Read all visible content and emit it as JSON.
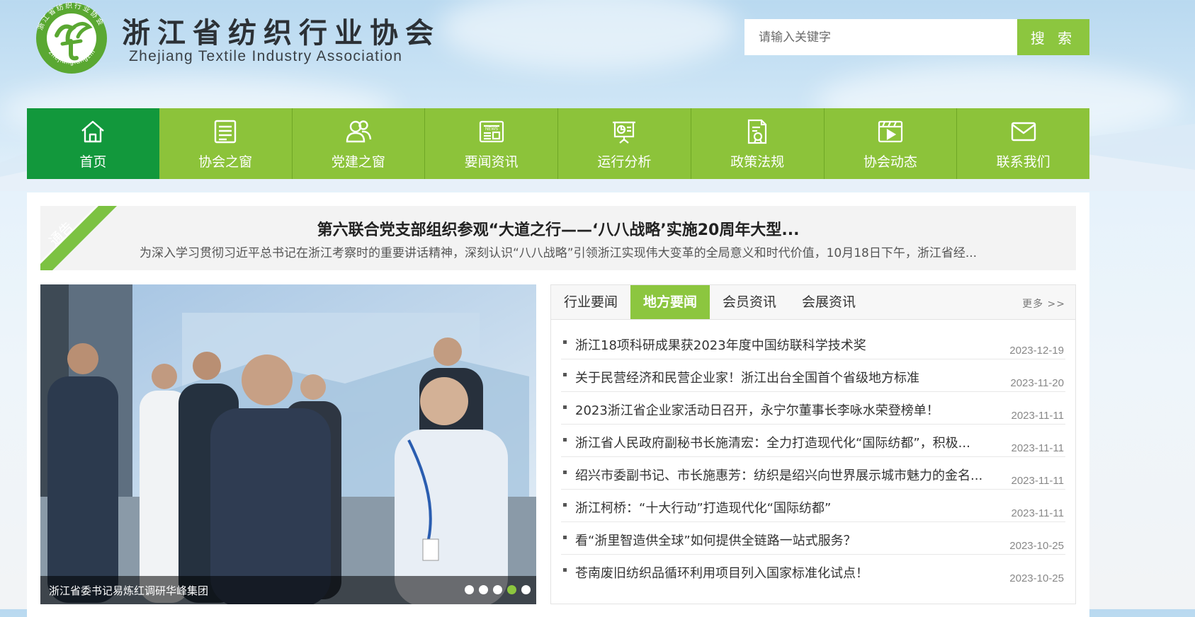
{
  "header": {
    "logo_ring_text": "浙江省纺织行业协会",
    "logo_ring_text_en": "zhejiangfangzhi",
    "title_cn": "浙江省纺织行业协会",
    "title_en": "Zhejiang Textile Industry Association",
    "search": {
      "placeholder": "请输入关键字",
      "value": "",
      "button_label": "搜 索"
    }
  },
  "nav": {
    "items": [
      {
        "label": "首页",
        "icon": "home-icon",
        "active": true
      },
      {
        "label": "协会之窗",
        "icon": "document-list-icon"
      },
      {
        "label": "党建之窗",
        "icon": "people-icon"
      },
      {
        "label": "要闻资讯",
        "icon": "newspaper-icon"
      },
      {
        "label": "运行分析",
        "icon": "presentation-chart-icon"
      },
      {
        "label": "政策法规",
        "icon": "policy-document-icon"
      },
      {
        "label": "协会动态",
        "icon": "video-icon"
      },
      {
        "label": "联系我们",
        "icon": "mail-icon"
      }
    ]
  },
  "notice": {
    "ribbon_label": "通告",
    "title": "第六联合党支部组织参观“大道之行——‘八八战略’实施20周年大型...",
    "summary": "为深入学习贯彻习近平总书记在浙江考察时的重要讲话精神，深刻认识“八八战略”引领浙江实现伟大变革的全局意义和时代价值，10月18日下午，浙江省经..."
  },
  "slider": {
    "caption": "浙江省委书记易炼红调研华峰集团",
    "dot_count": 5,
    "active_dot": 4
  },
  "news": {
    "tabs": [
      {
        "label": "行业要闻"
      },
      {
        "label": "地方要闻",
        "active": true
      },
      {
        "label": "会员资讯"
      },
      {
        "label": "会展资讯"
      }
    ],
    "more_label": "更多 >>",
    "items": [
      {
        "title": "浙江18项科研成果获2023年度中国纺联科学技术奖",
        "date": "2023-12-19"
      },
      {
        "title": "关于民营经济和民营企业家！浙江出台全国首个省级地方标准",
        "date": "2023-11-20"
      },
      {
        "title": "2023浙江省企业家活动日召开，永宁尔董事长李咏水荣登榜单！",
        "date": "2023-11-11"
      },
      {
        "title": "浙江省人民政府副秘书长施清宏：全力打造现代化“国际纺都”，积极...",
        "date": "2023-11-11"
      },
      {
        "title": "绍兴市委副书记、市长施惠芳：纺织是绍兴向世界展示城市魅力的金名...",
        "date": "2023-11-11"
      },
      {
        "title": "浙江柯桥：“十大行动”打造现代化“国际纺都”",
        "date": "2023-11-11"
      },
      {
        "title": "看“浙里智造供全球”如何提供全链路一站式服务？",
        "date": "2023-10-25"
      },
      {
        "title": "苍南废旧纺织品循环利用项目列入国家标准化试点！",
        "date": "2023-10-25"
      }
    ]
  },
  "colors": {
    "primary_green": "#8cc63f",
    "active_green": "#12983c"
  }
}
